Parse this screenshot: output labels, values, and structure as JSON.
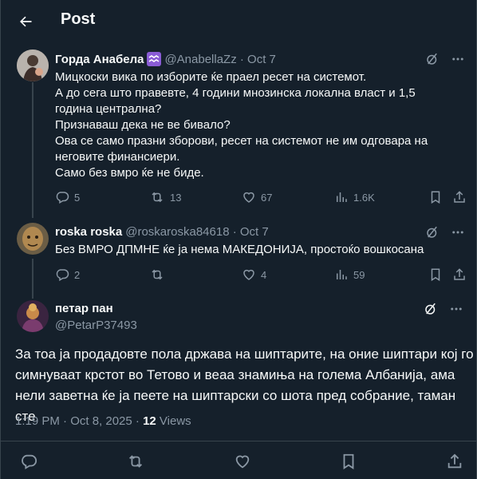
{
  "header": {
    "title": "Post"
  },
  "replies": [
    {
      "name": "Горда Анабела",
      "handle": "@AnabellaZz · Oct 7",
      "lines": [
        "Мицкоски вика по изборите ќе праел ресет на системот.",
        "А до сега што правевте, 4 години мнозинска локална власт и 1,5 година централна?",
        "Признаваш дека не ве бивало?",
        "Ова се само празни зборови, ресет на системот не им одговара на неговите финансиери.",
        "Само без вмро ќе не биде."
      ],
      "stats": {
        "replies": "5",
        "reposts": "13",
        "likes": "67",
        "views": "1.6K"
      }
    },
    {
      "name": "roska roska",
      "handle": "@roskaroska84618 · Oct 7",
      "lines": [
        "Без ВМРО ДПМНЕ ќе ја нема МАКЕДОНИЈА, простоќо вошкосана"
      ],
      "stats": {
        "replies": "2",
        "reposts": "",
        "likes": "4",
        "views": "59"
      }
    }
  ],
  "main_post": {
    "name": "петар пан",
    "handle": "@PetarP37493",
    "text": "За тоа ја продадовте пола држава на шиптарите, на оние шиптари кој го симнуваат крстот во Тетово и веаа знамиња на голема Албанија, ама нели заветна ќе ја пеете на шиптарски со шота пред собрание, таман сте",
    "timestamp": "1:19 PM · Oct 8, 2025 · ",
    "views_count": "12",
    "views_label": " Views"
  },
  "colors": {
    "background": "#15202b",
    "border": "#38444d",
    "text": "#f7f9f9",
    "secondary": "#8b98a5",
    "badge": "#8a5cd6"
  },
  "icons": [
    "back-arrow-icon",
    "grok-icon",
    "more-icon",
    "reply-icon",
    "repost-icon",
    "like-icon",
    "views-icon",
    "bookmark-icon",
    "share-icon"
  ]
}
